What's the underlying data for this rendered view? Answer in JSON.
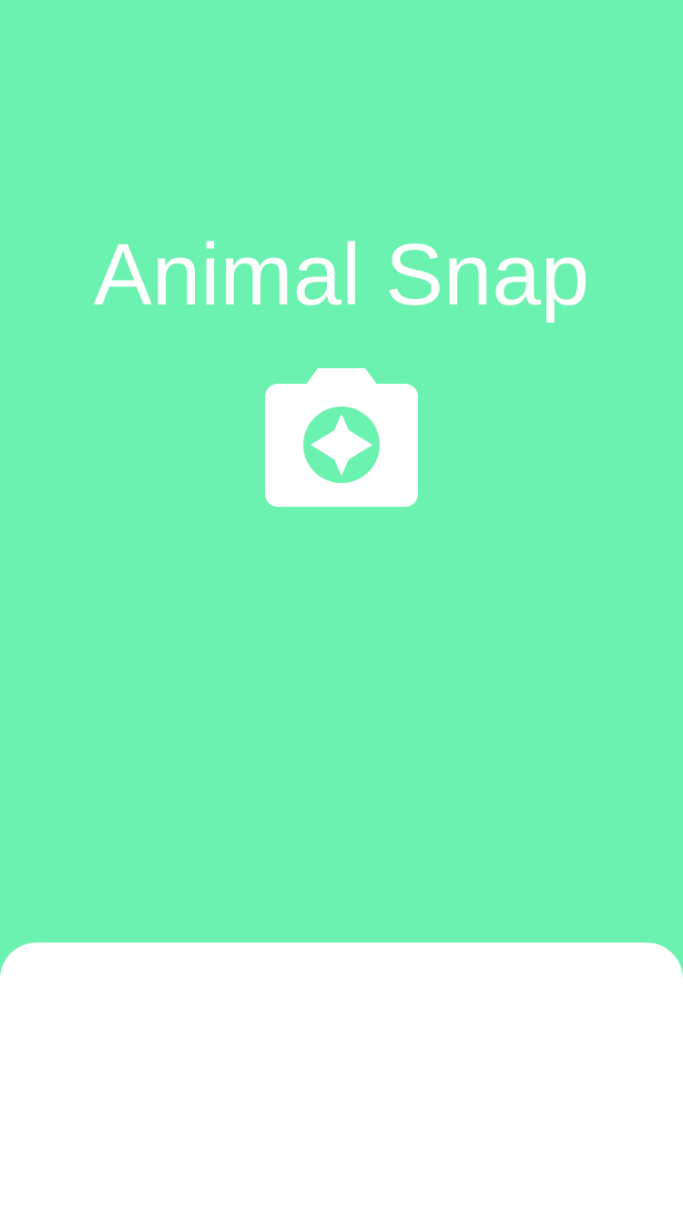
{
  "app": {
    "title": "Animal Snap",
    "logo_icon": "camera-sparkle-icon"
  },
  "colors": {
    "background": "#6cf2b0",
    "foreground": "#ffffff",
    "sheet": "#ffffff"
  }
}
